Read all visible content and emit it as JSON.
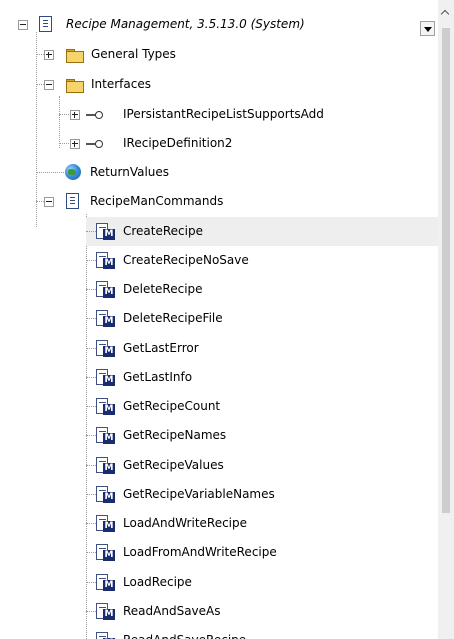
{
  "tree": {
    "root": {
      "label": "Recipe Management, 3.5.13.0 (System)"
    },
    "general_types": {
      "label": "General Types"
    },
    "interfaces": {
      "label": "Interfaces",
      "items": [
        {
          "label": "IPersistantRecipeListSupportsAdd"
        },
        {
          "label": "IRecipeDefinition2"
        }
      ]
    },
    "return_values": {
      "label": "ReturnValues"
    },
    "commands": {
      "label": "RecipeManCommands",
      "methods": [
        {
          "label": "CreateRecipe"
        },
        {
          "label": "CreateRecipeNoSave"
        },
        {
          "label": "DeleteRecipe"
        },
        {
          "label": "DeleteRecipeFile"
        },
        {
          "label": "GetLastError"
        },
        {
          "label": "GetLastInfo"
        },
        {
          "label": "GetRecipeCount"
        },
        {
          "label": "GetRecipeNames"
        },
        {
          "label": "GetRecipeValues"
        },
        {
          "label": "GetRecipeVariableNames"
        },
        {
          "label": "LoadAndWriteRecipe"
        },
        {
          "label": "LoadFromAndWriteRecipe"
        },
        {
          "label": "LoadRecipe"
        },
        {
          "label": "ReadAndSaveAs"
        },
        {
          "label": "ReadAndSaveRecipe"
        }
      ]
    }
  },
  "icons": {
    "root": "library-document-icon",
    "folder": "folder-icon",
    "interface": "interface-icon",
    "globe": "globe-icon",
    "pou": "document-icon",
    "method": "method-icon"
  },
  "colors": {
    "selected_row": "#eeeeee",
    "method_badge": "#1a2c70",
    "folder": "#f6d46c"
  }
}
